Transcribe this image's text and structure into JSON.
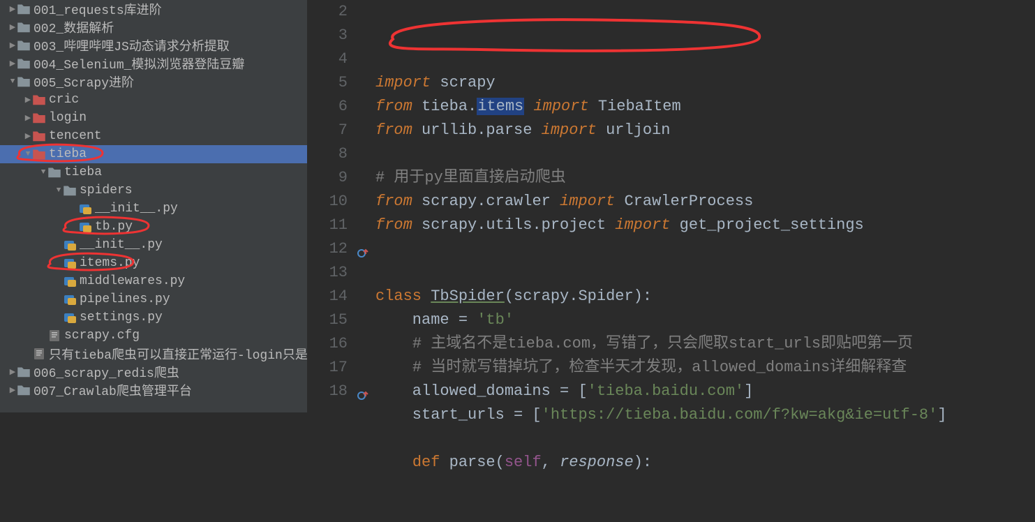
{
  "tree": [
    {
      "depth": 0,
      "arrow": "collapsed",
      "icon": "folder",
      "label": "001_requests库进阶",
      "selected": false
    },
    {
      "depth": 0,
      "arrow": "collapsed",
      "icon": "folder",
      "label": "002_数据解析",
      "selected": false
    },
    {
      "depth": 0,
      "arrow": "collapsed",
      "icon": "folder",
      "label": "003_哔哩哔哩JS动态请求分析提取",
      "selected": false
    },
    {
      "depth": 0,
      "arrow": "collapsed",
      "icon": "folder",
      "label": "004_Selenium_模拟浏览器登陆豆瓣",
      "selected": false
    },
    {
      "depth": 0,
      "arrow": "expanded",
      "icon": "folder",
      "label": "005_Scrapy进阶",
      "selected": false
    },
    {
      "depth": 1,
      "arrow": "collapsed",
      "icon": "folder-red",
      "label": "cric",
      "selected": false
    },
    {
      "depth": 1,
      "arrow": "collapsed",
      "icon": "folder-red",
      "label": "login",
      "selected": false
    },
    {
      "depth": 1,
      "arrow": "collapsed",
      "icon": "folder-red",
      "label": "tencent",
      "selected": false
    },
    {
      "depth": 1,
      "arrow": "expanded",
      "icon": "folder-red",
      "label": "tieba",
      "selected": true,
      "circle": "tree-tieba"
    },
    {
      "depth": 2,
      "arrow": "expanded",
      "icon": "folder",
      "label": "tieba",
      "selected": false
    },
    {
      "depth": 3,
      "arrow": "expanded",
      "icon": "folder",
      "label": "spiders",
      "selected": false
    },
    {
      "depth": 4,
      "arrow": "none",
      "icon": "py",
      "label": "__init__.py",
      "selected": false
    },
    {
      "depth": 4,
      "arrow": "none",
      "icon": "py",
      "label": "tb.py",
      "selected": false,
      "circle": "tree-tb"
    },
    {
      "depth": 3,
      "arrow": "none",
      "icon": "py",
      "label": "__init__.py",
      "selected": false
    },
    {
      "depth": 3,
      "arrow": "none",
      "icon": "py",
      "label": "items.py",
      "selected": false,
      "circle": "tree-items"
    },
    {
      "depth": 3,
      "arrow": "none",
      "icon": "py",
      "label": "middlewares.py",
      "selected": false
    },
    {
      "depth": 3,
      "arrow": "none",
      "icon": "py",
      "label": "pipelines.py",
      "selected": false
    },
    {
      "depth": 3,
      "arrow": "none",
      "icon": "py",
      "label": "settings.py",
      "selected": false
    },
    {
      "depth": 2,
      "arrow": "none",
      "icon": "txt",
      "label": "scrapy.cfg",
      "selected": false
    },
    {
      "depth": 1,
      "arrow": "none",
      "icon": "txt",
      "label": "只有tieba爬虫可以直接正常运行-login只是模拟登录-c",
      "selected": false
    },
    {
      "depth": 0,
      "arrow": "collapsed",
      "icon": "folder",
      "label": "006_scrapy_redis爬虫",
      "selected": false
    },
    {
      "depth": 0,
      "arrow": "collapsed",
      "icon": "folder",
      "label": "007_Crawlab爬虫管理平台",
      "selected": false
    }
  ],
  "code": {
    "start": 2,
    "lines": [
      [
        {
          "t": "kw",
          "v": "import"
        },
        {
          "t": "id",
          "v": " scrapy"
        }
      ],
      [
        {
          "t": "kw",
          "v": "from"
        },
        {
          "t": "id",
          "v": " tieba."
        },
        {
          "t": "items-hl",
          "v": "items"
        },
        {
          "t": "id",
          "v": " "
        },
        {
          "t": "kw",
          "v": "import"
        },
        {
          "t": "id",
          "v": " TiebaItem"
        }
      ],
      [
        {
          "t": "kw",
          "v": "from"
        },
        {
          "t": "id",
          "v": " urllib.parse "
        },
        {
          "t": "kw",
          "v": "import"
        },
        {
          "t": "id",
          "v": " urljoin"
        }
      ],
      [],
      [
        {
          "t": "cm",
          "v": "# 用于py里面直接启动爬虫"
        }
      ],
      [
        {
          "t": "kw",
          "v": "from"
        },
        {
          "t": "id",
          "v": " scrapy.crawler "
        },
        {
          "t": "kw",
          "v": "import"
        },
        {
          "t": "id",
          "v": " CrawlerProcess"
        }
      ],
      [
        {
          "t": "kw",
          "v": "from"
        },
        {
          "t": "id",
          "v": " scrapy.utils.project "
        },
        {
          "t": "kw",
          "v": "import"
        },
        {
          "t": "id",
          "v": " get_project_settings"
        }
      ],
      [],
      [],
      [
        {
          "t": "kw2",
          "v": "class "
        },
        {
          "t": "cls",
          "v": "TbSpider"
        },
        {
          "t": "id",
          "v": "(scrapy.Spider):"
        }
      ],
      [
        {
          "t": "id",
          "v": "    name = "
        },
        {
          "t": "str",
          "v": "'tb'"
        }
      ],
      [
        {
          "t": "id",
          "v": "    "
        },
        {
          "t": "cm",
          "v": "# 主域名不是tieba.com，写错了，只会爬取start_urls即贴吧第一页"
        }
      ],
      [
        {
          "t": "id",
          "v": "    "
        },
        {
          "t": "cm",
          "v": "# 当时就写错掉坑了，检查半天才发现，allowed_domains详细解释查"
        }
      ],
      [
        {
          "t": "id",
          "v": "    allowed_domains = ["
        },
        {
          "t": "str",
          "v": "'tieba.baidu.com'"
        },
        {
          "t": "id",
          "v": "]"
        }
      ],
      [
        {
          "t": "id",
          "v": "    start_urls = ["
        },
        {
          "t": "str",
          "v": "'https://tieba.baidu.com/f?kw=akg&ie=utf-8'"
        },
        {
          "t": "id",
          "v": "]"
        }
      ],
      [],
      [
        {
          "t": "id",
          "v": "    "
        },
        {
          "t": "kw2",
          "v": "def "
        },
        {
          "t": "id",
          "v": "parse("
        },
        {
          "t": "self",
          "v": "self"
        },
        {
          "t": "id",
          "v": ", "
        },
        {
          "t": "param",
          "v": "response"
        },
        {
          "t": "id",
          "v": "):"
        }
      ]
    ]
  },
  "gutter_icons": [
    {
      "line": 12,
      "type": "override"
    },
    {
      "line": 18,
      "type": "override"
    }
  ]
}
